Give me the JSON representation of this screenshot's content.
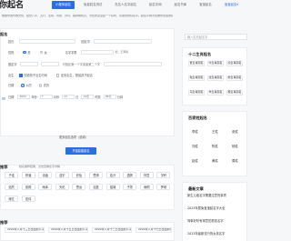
{
  "header": {
    "title": "你起名",
    "nav": [
      "小程序起名",
      "免费姓名测试",
      "在名人名字起名",
      "起名字网",
      "起名书库",
      "宝宝起名",
      "热门起名",
      "登录"
    ],
    "nav_dropdown": "宝宝起名▾"
  },
  "intro": "根据中国传统文化，结合八字、五行、生肖、周易、诗词、楚辞等知识，为您的宝宝起一个好听、有寓意的好名字。起名字网为您推荐合适的名字",
  "form": {
    "section_label": "起名",
    "surname_label": "姓氏",
    "surname_placeholder": "请输入姓氏",
    "gender_label": "性别",
    "gender_options": [
      "男",
      "女"
    ],
    "gender_selected": "男",
    "name_length_label": "名字字数",
    "name_length_placeholder": "如：王泽锐",
    "fixed_char_label": "固定字",
    "fixed_char_text": "可指定第一个字或者第二个字",
    "birth_label": "出生",
    "birth_options": [
      "知道孩子出生时间",
      "还未出生，想给孩子起名"
    ],
    "calendar_label": "日期",
    "calendar_options": [
      "公历",
      "农历"
    ],
    "date_fields": [
      "年份",
      "月份",
      "日",
      "时辰",
      "分钟"
    ],
    "date_values": [
      "2022",
      "7",
      "13",
      "14点",
      "46分"
    ],
    "more_link": "更多起名选项（选填）",
    "submit": "开始智能起名"
  },
  "results": {
    "label": "推荐",
    "subtitle": "姓名推荐结果，点击查看名字详解",
    "names": [
      [
        "子诺",
        "梓涵",
        "诗涵",
        "浩宇",
        "欣怡",
        "思琪",
        "若汐",
        "语嫣",
        "梓萱",
        "宇轩"
      ],
      [
        "浩然",
        "俊熙",
        "雨泽",
        "天佑",
        "思远",
        "嘉懿",
        "煜城",
        "子墨",
        "雨桐",
        "梦琪"
      ],
      [
        "博文",
        "宏伟"
      ]
    ]
  },
  "recommend": {
    "label": "推荐",
    "items": [
      "2022年八月十三日出生的八字",
      "2022年八月十五日出生的八字",
      "2022年八月十二日出生的八字",
      "2022年八月十七日出生的八字"
    ]
  },
  "side": {
    "search_placeholder": "输入姓氏起名字",
    "zodiac_title": "十二生肖起名",
    "zodiac": [
      "鼠生肖起名",
      "牛生肖起名",
      "虎生肖起名",
      "兔生肖起名",
      "龙生肖起名",
      "蛇生肖起名",
      "马生肖起名",
      "羊生肖起名",
      "猴生肖起名"
    ],
    "hot_title": "百家姓起名",
    "hot": [
      "李姓",
      "王姓",
      "张姓",
      "刘姓",
      "陈姓",
      "杨姓",
      "赵姓",
      "黄姓",
      "周姓"
    ],
    "articles_title": "最新文章",
    "articles": [
      "新生儿取名字需要注意的事项",
      "2023年属兔宝宝起名字大全",
      "简单好听有寓意的男孩名字",
      "2023年最新流行的女孩名字"
    ]
  }
}
